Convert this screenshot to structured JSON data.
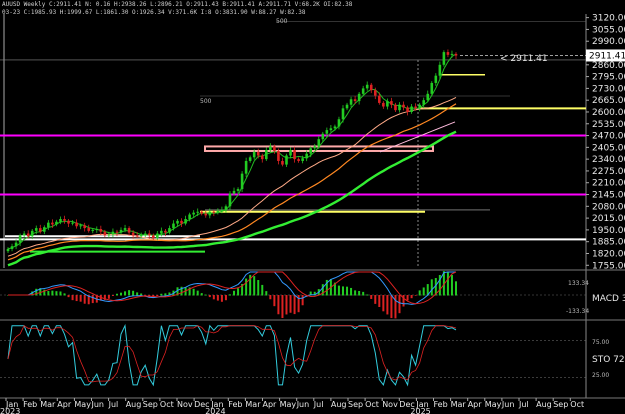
{
  "header": {
    "line1": "AUUSD Weekly  C:2911.41  N:  0.16  H:2938.26  L:2896.21  O:2911.43  B:2911.41  A:2911.71  V:68.2K  OI:82.38",
    "line2": "03-23  C:1985.93  H:1999.67  L:1861.30  O:1926.34  V:371.6K  I:8  O:3831.90  W:88.27  W:82.38"
  },
  "price_marker": "< 2911.41",
  "colors": {
    "background": "#000000",
    "up_candle": "#22cc22",
    "down_candle": "#dd2222",
    "magenta_level": "#ff00ff",
    "yellow_level": "#ffff66",
    "white_level": "#ffffff",
    "pink_zone": "#ffaaaa",
    "ma_green_bright": "#33ee33",
    "ma_green": "#22bb22",
    "ma_orange": "#ff8822",
    "ma_salmon": "#ffaa88",
    "ma_pink": "#ffbbdd",
    "macd_line": "#3399ff",
    "signal_line": "#dd2222",
    "sto_line": "#33ccdd"
  },
  "annotations": {
    "round_500_upper": "500",
    "round_500_lower": "500"
  },
  "indicators": {
    "macd_label": "MACD 3,",
    "macd_tick": "133.34",
    "macd_tick_low": "-133.34",
    "sto_label": "STO  72,",
    "sto_75": "75.00",
    "sto_25": "25.00"
  },
  "chart_data": {
    "type": "candlestick",
    "ylim": [
      1740,
      3140
    ],
    "yticks": [
      "3120.00",
      "3055.00",
      "2990.00",
      "2925.00",
      "2860.00",
      "2795.00",
      "2730.00",
      "2665.00",
      "2600.00",
      "2535.00",
      "2470.00",
      "2405.00",
      "2340.00",
      "2275.00",
      "2210.00",
      "2145.00",
      "2080.00",
      "2015.00",
      "1950.00",
      "1885.00",
      "1820.00",
      "1755.00"
    ],
    "xticks": [
      "Jan",
      "Feb",
      "Mar",
      "Apr",
      "May",
      "Jun",
      "Jul",
      "Aug",
      "Sep",
      "Oct",
      "Nov",
      "Dec",
      "Jan",
      "Feb",
      "Mar",
      "Apr",
      "May",
      "Jun",
      "Jul",
      "Aug",
      "Sep",
      "Oct",
      "Nov",
      "Dec",
      "Jan",
      "Feb",
      "Mar",
      "Apr",
      "May",
      "Jun",
      "Jul",
      "Aug",
      "Sep",
      "Oct"
    ],
    "year_labels": [
      "2023",
      "2024",
      "2025"
    ],
    "last_price": 2911.41,
    "levels": [
      {
        "name": "magenta-upper",
        "value": 2470,
        "color": "magenta_level"
      },
      {
        "name": "magenta-lower",
        "value": 2145,
        "color": "magenta_level"
      },
      {
        "name": "yellow-upper",
        "value": 2620,
        "color": "yellow_level"
      },
      {
        "name": "yellow-lower",
        "value": 2050,
        "color": "yellow_level"
      },
      {
        "name": "white-lower",
        "value": 1898,
        "color": "white_level"
      }
    ],
    "closes": [
      1845,
      1860,
      1880,
      1920,
      1930,
      1915,
      1945,
      1960,
      1940,
      1965,
      1990,
      1980,
      1995,
      2010,
      2000,
      1985,
      1990,
      1970,
      1975,
      1960,
      1945,
      1950,
      1955,
      1940,
      1920,
      1925,
      1940,
      1935,
      1950,
      1960,
      1935,
      1920,
      1915,
      1925,
      1930,
      1920,
      1905,
      1930,
      1945,
      1935,
      1960,
      1985,
      2000,
      1985,
      2010,
      2035,
      2045,
      2050,
      2040,
      2030,
      2050,
      2045,
      2055,
      2060,
      2080,
      2150,
      2165,
      2175,
      2260,
      2330,
      2350,
      2380,
      2360,
      2340,
      2390,
      2410,
      2385,
      2330,
      2310,
      2360,
      2390,
      2340,
      2330,
      2345,
      2370,
      2400,
      2410,
      2450,
      2480,
      2500,
      2510,
      2520,
      2560,
      2620,
      2640,
      2670,
      2660,
      2700,
      2730,
      2750,
      2720,
      2690,
      2650,
      2630,
      2660,
      2640,
      2610,
      2640,
      2625,
      2600,
      2630,
      2620,
      2640,
      2665,
      2700,
      2760,
      2800,
      2860,
      2930,
      2915,
      2920,
      2911
    ]
  }
}
